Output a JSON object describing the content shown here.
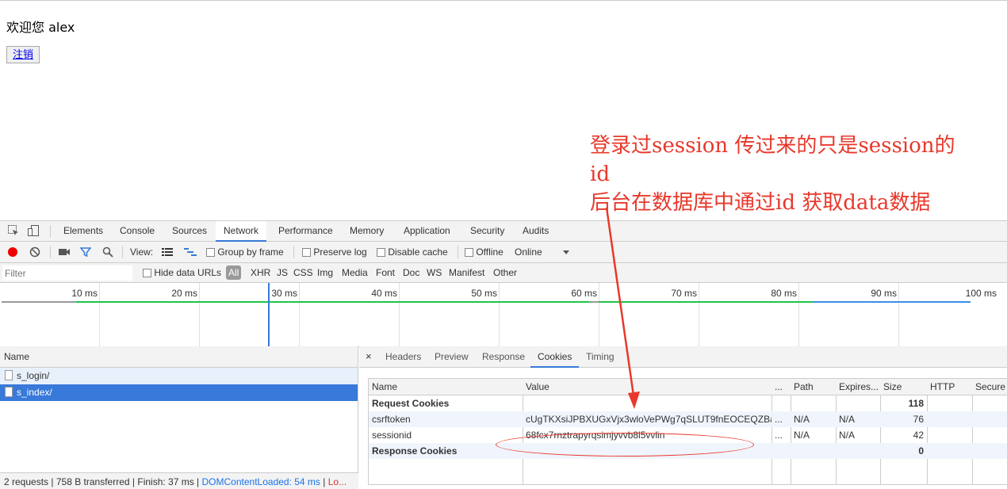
{
  "page": {
    "welcome": "欢迎您 alex",
    "logout_label": "注销"
  },
  "annotation": {
    "line1": "登录过session 传过来的只是session的",
    "line2": "id",
    "line3": "后台在数据库中通过id 获取data数据"
  },
  "devtools": {
    "tabs": [
      "Elements",
      "Console",
      "Sources",
      "Network",
      "Performance",
      "Memory",
      "Application",
      "Security",
      "Audits"
    ],
    "active_tab": "Network",
    "toolbar": {
      "view_label": "View:",
      "group_by_frame": "Group by frame",
      "preserve_log": "Preserve log",
      "disable_cache": "Disable cache",
      "offline": "Offline",
      "online": "Online"
    },
    "filterbar": {
      "filter_placeholder": "Filter",
      "hide_data_urls": "Hide data URLs",
      "types": [
        "All",
        "XHR",
        "JS",
        "CSS",
        "Img",
        "Media",
        "Font",
        "Doc",
        "WS",
        "Manifest",
        "Other"
      ]
    },
    "timeline": {
      "ticks": [
        "10 ms",
        "20 ms",
        "30 ms",
        "40 ms",
        "50 ms",
        "60 ms",
        "70 ms",
        "80 ms",
        "90 ms",
        "100 ms"
      ]
    },
    "requests": {
      "header": "Name",
      "items": [
        "s_login/",
        "s_index/"
      ]
    },
    "status": {
      "requests": "2 requests",
      "transferred": "758 B transferred",
      "finish": "Finish: 37 ms",
      "dcl": "DOMContentLoaded: 54 ms",
      "load": "Lo..."
    },
    "detail": {
      "close": "×",
      "tabs": [
        "Headers",
        "Preview",
        "Response",
        "Cookies",
        "Timing"
      ],
      "active_tab": "Cookies"
    },
    "cookies": {
      "columns": [
        "Name",
        "Value",
        "...",
        "Path",
        "Expires...",
        "Size",
        "HTTP",
        "Secure"
      ],
      "rows": [
        {
          "name": "Request Cookies",
          "value": "",
          "dots": "",
          "path": "",
          "expires": "",
          "size": "118",
          "section": true
        },
        {
          "name": "csrftoken",
          "value": "cUgTKXsiJPBXUGxVjx3wloVePWg7qSLUT9fnEOCEQZBa...",
          "dots": "...",
          "path": "N/A",
          "expires": "N/A",
          "size": "76",
          "section": false
        },
        {
          "name": "sessionid",
          "value": "68fcx7rnztrapyrqsimjyvvb8l5vvlin",
          "dots": "...",
          "path": "N/A",
          "expires": "N/A",
          "size": "42",
          "section": false
        },
        {
          "name": "Response Cookies",
          "value": "",
          "dots": "",
          "path": "",
          "expires": "",
          "size": "0",
          "section": true
        }
      ]
    }
  },
  "colors": {
    "annotation_red": "#e8382b",
    "accent_blue": "#3879d9",
    "record_red": "#ee0000"
  }
}
